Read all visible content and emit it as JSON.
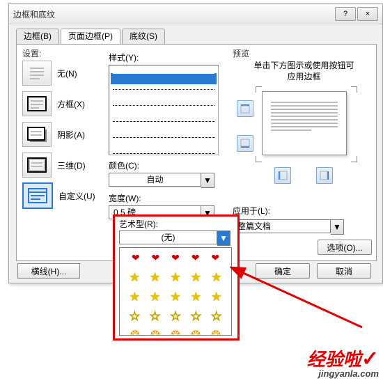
{
  "dialog": {
    "title": "边框和底纹",
    "help_icon": "?",
    "close_icon": "×"
  },
  "tabs": {
    "border": "边框(B)",
    "page_border": "页面边框(P)",
    "shading": "底纹(S)"
  },
  "settings": {
    "heading": "设置:",
    "none": "无(N)",
    "box": "方框(X)",
    "shadow": "阴影(A)",
    "threed": "三维(D)",
    "custom": "自定义(U)"
  },
  "style": {
    "heading": "样式(Y):",
    "color_label": "颜色(C):",
    "color_value": "自动",
    "width_label": "宽度(W):",
    "width_value": "0.5 磅",
    "art_label": "艺术型(R):",
    "art_value": "(无)"
  },
  "preview": {
    "heading": "预览",
    "hint_line1": "单击下方图示或使用按钮可",
    "hint_line2": "应用边框"
  },
  "apply": {
    "label": "应用于(L):",
    "value": "整篇文档"
  },
  "buttons": {
    "options": "选项(O)...",
    "hline": "横线(H)...",
    "ok": "确定",
    "cancel": "取消"
  },
  "watermark": {
    "line1": "经验啦",
    "check": "✓",
    "line2": "jingyanla.com"
  }
}
